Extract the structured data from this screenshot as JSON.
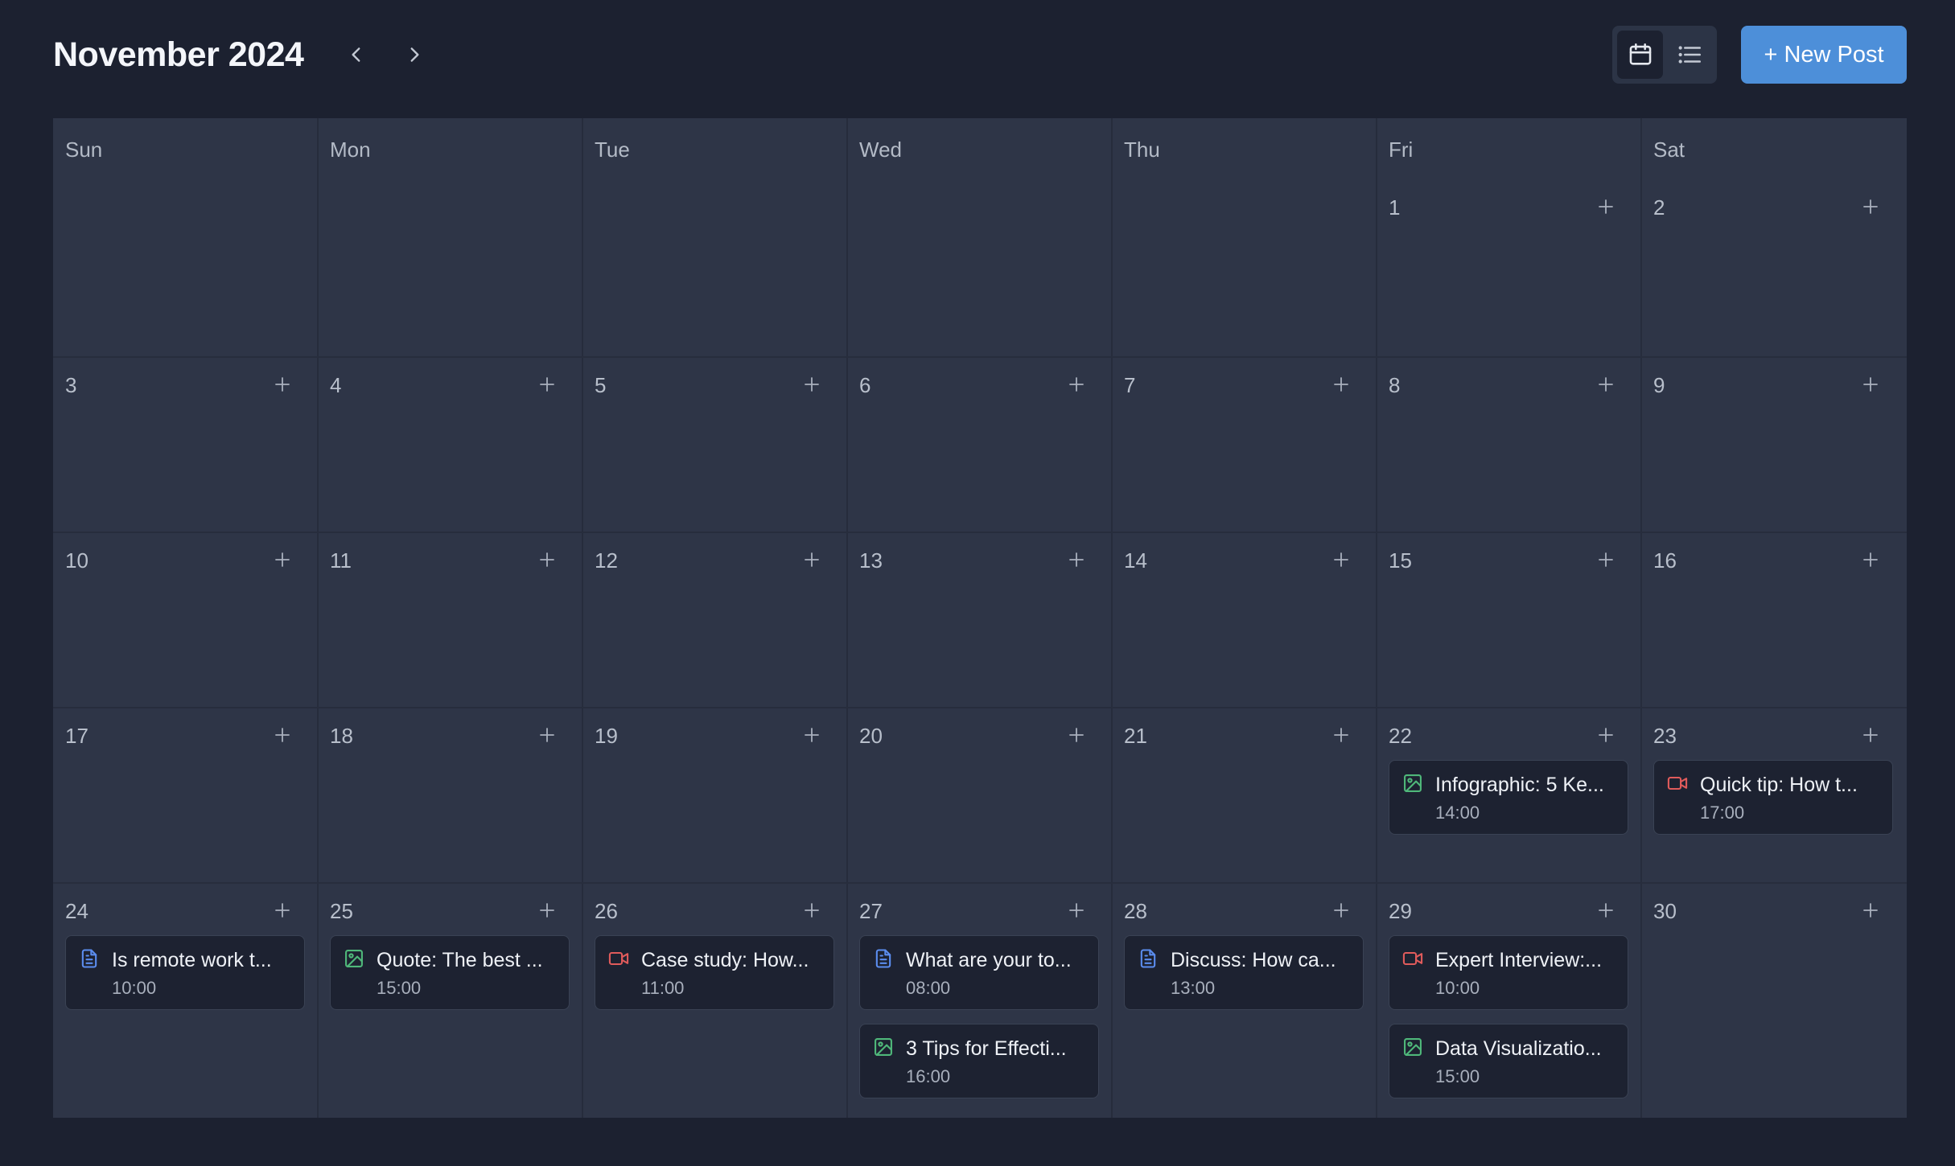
{
  "header": {
    "title": "November 2024",
    "new_post_label": "+ New Post"
  },
  "colors": {
    "background": "#1c2130",
    "grid": "#2e3547",
    "event_card": "#1d2231",
    "accent": "#4d8fd9",
    "text_icon": "#5b8def",
    "image_icon": "#4fb87a",
    "video_icon": "#e05b5b"
  },
  "weekdays": [
    "Sun",
    "Mon",
    "Tue",
    "Wed",
    "Thu",
    "Fri",
    "Sat"
  ],
  "weeks": [
    [
      null,
      null,
      null,
      null,
      null,
      "1",
      "2"
    ],
    [
      "3",
      "4",
      "5",
      "6",
      "7",
      "8",
      "9"
    ],
    [
      "10",
      "11",
      "12",
      "13",
      "14",
      "15",
      "16"
    ],
    [
      "17",
      "18",
      "19",
      "20",
      "21",
      "22",
      "23"
    ],
    [
      "24",
      "25",
      "26",
      "27",
      "28",
      "29",
      "30"
    ]
  ],
  "events": {
    "22": [
      {
        "title": "Infographic: 5 Ke...",
        "time": "14:00",
        "type": "image-icon"
      }
    ],
    "23": [
      {
        "title": "Quick tip: How t...",
        "time": "17:00",
        "type": "video-icon"
      }
    ],
    "24": [
      {
        "title": "Is remote work t...",
        "time": "10:00",
        "type": "document-icon"
      }
    ],
    "25": [
      {
        "title": "Quote: The best ...",
        "time": "15:00",
        "type": "image-icon"
      }
    ],
    "26": [
      {
        "title": "Case study: How...",
        "time": "11:00",
        "type": "video-icon"
      }
    ],
    "27": [
      {
        "title": "What are your to...",
        "time": "08:00",
        "type": "document-icon"
      },
      {
        "title": "3 Tips for Effecti...",
        "time": "16:00",
        "type": "image-icon"
      }
    ],
    "28": [
      {
        "title": "Discuss: How ca...",
        "time": "13:00",
        "type": "document-icon"
      }
    ],
    "29": [
      {
        "title": "Expert Interview:...",
        "time": "10:00",
        "type": "video-icon"
      },
      {
        "title": "Data Visualizatio...",
        "time": "15:00",
        "type": "image-icon"
      }
    ]
  }
}
